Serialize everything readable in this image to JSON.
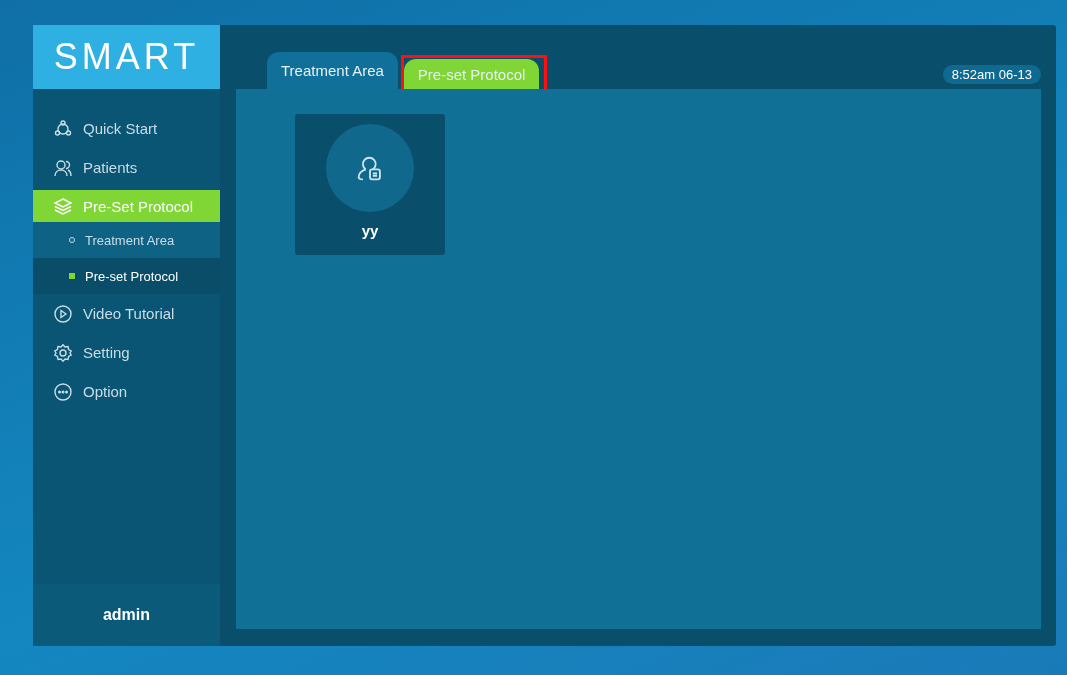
{
  "logo": "SMART",
  "sidebar": {
    "items": [
      {
        "label": "Quick Start",
        "kind": "quick",
        "selected": false
      },
      {
        "label": "Patients",
        "kind": "patients",
        "selected": false
      },
      {
        "label": "Pre-Set Protocol",
        "kind": "layers",
        "selected": true,
        "children": [
          {
            "label": "Treatment Area",
            "selected": false
          },
          {
            "label": "Pre-set Protocol",
            "selected": true
          }
        ]
      },
      {
        "label": "Video Tutorial",
        "kind": "play",
        "selected": false
      },
      {
        "label": "Setting",
        "kind": "gear",
        "selected": false
      },
      {
        "label": "Option",
        "kind": "more",
        "selected": false
      }
    ],
    "user": "admin"
  },
  "tabs": [
    {
      "label": "Treatment Area",
      "selected": false,
      "highlighted": false
    },
    {
      "label": "Pre-set Protocol",
      "selected": true,
      "highlighted": true
    }
  ],
  "clock": "8:52am  06-13",
  "protocols": [
    {
      "name": "yy"
    }
  ]
}
